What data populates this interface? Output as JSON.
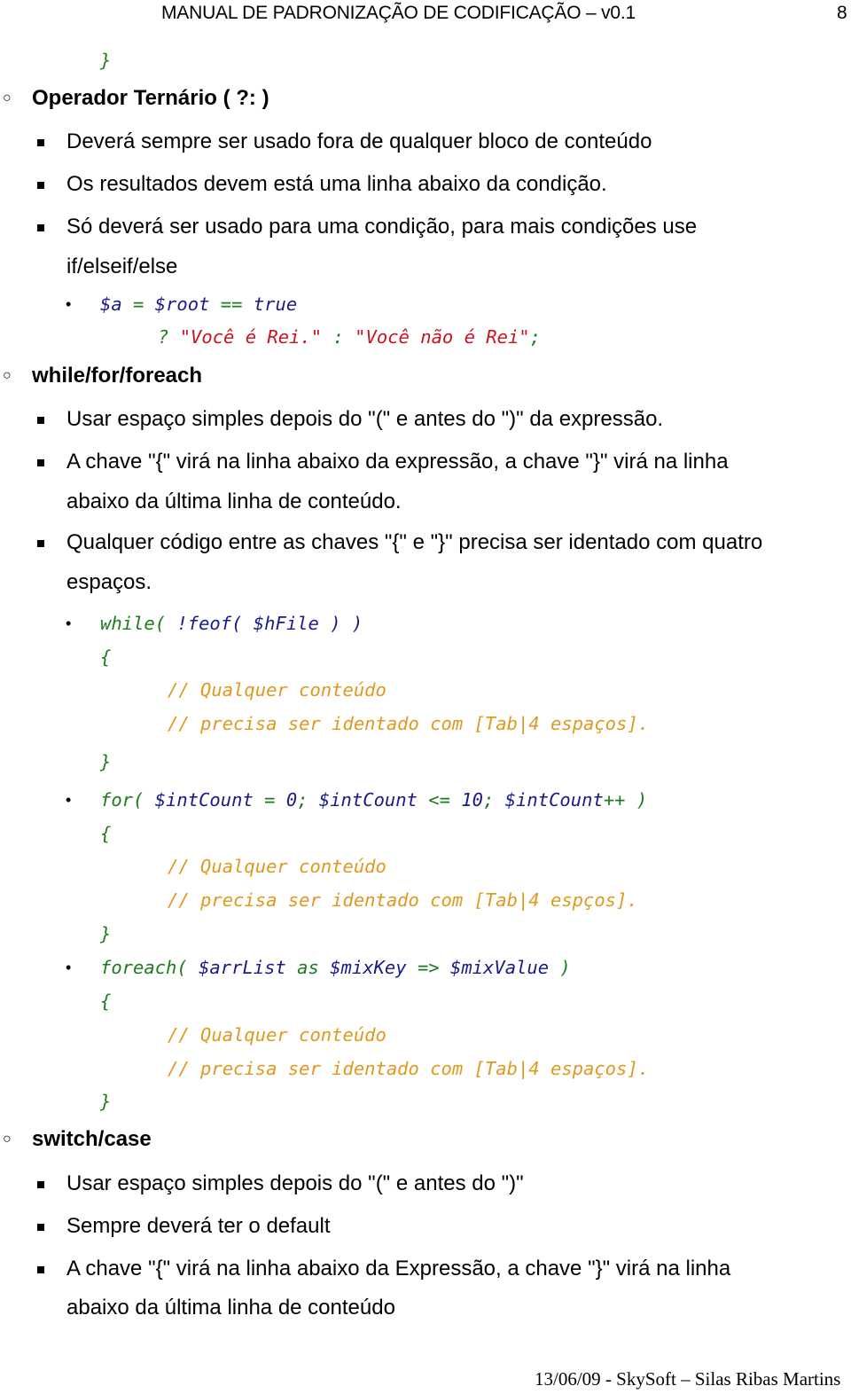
{
  "header": {
    "title": "MANUAL DE PADRONIZAÇÃO DE CODIFICAÇÃO – v0.1",
    "page_number": "8"
  },
  "colors": {
    "keyword": "#1e7a1e",
    "variable": "#1a1a8c",
    "string": "#c8141e",
    "comment": "#e0981e"
  },
  "carry_over": {
    "closing_brace": "}"
  },
  "sections": {
    "ternary": {
      "heading": "Operador Ternário ( ?: )",
      "rules": [
        "Deverá sempre ser usado fora de qualquer bloco de conteúdo",
        "Os resultados devem está uma linha abaixo da condição.",
        "Só deverá ser usado para uma condição, para mais condições use",
        "if/elseif/else"
      ],
      "code": {
        "l1_var_a": "$a",
        "l1_eq": " = ",
        "l1_var_root": "$root",
        "l1_op": " == ",
        "l1_true": "true",
        "l2_q": "? ",
        "l2_str1": "\"Você é Rei.\"",
        "l2_colon": " : ",
        "l2_str2": "\"Você não é Rei\"",
        "l2_semi": ";"
      }
    },
    "loops": {
      "heading": "while/for/foreach",
      "rules": [
        "Usar espaço simples depois do \"(\" e antes do \")\" da expressão.",
        "A chave \"{\" virá na linha abaixo da expressão, a chave \"}\" virá na linha",
        "abaixo da última linha de conteúdo.",
        "Qualquer código entre as chaves \"{\" e \"}\" precisa ser identado com quatro",
        "espaços."
      ],
      "while_code": {
        "kw": "while( ",
        "fn": "!feof( $hFile ) )",
        "open": "{",
        "c1": "// Qualquer conteúdo",
        "c2": "// precisa ser identado com [Tab|4 espaços].",
        "close": "}"
      },
      "for_code": {
        "kw": "for( ",
        "v1": "$intCount",
        "eq": " = ",
        "zero": "0",
        "semi1": "; ",
        "v2": "$intCount",
        "le": " <= ",
        "ten": "10",
        "semi2": "; ",
        "v3": "$intCount",
        "inc": "++ )",
        "open": "{",
        "c1": "// Qualquer conteúdo",
        "c2": "// precisa ser identado com [Tab|4 espços].",
        "close": "}"
      },
      "foreach_code": {
        "kw": "foreach( ",
        "v1": "$arrList",
        "as": " as ",
        "v2": "$mixKey",
        "arrow": " => ",
        "v3": "$mixValue",
        "end": " )",
        "open": "{",
        "c1": "// Qualquer conteúdo",
        "c2": "// precisa ser identado com [Tab|4 espaços].",
        "close": "}"
      }
    },
    "switch": {
      "heading": "switch/case",
      "rules": [
        "Usar espaço simples depois do \"(\" e antes do \")\"",
        "Sempre deverá ter o default",
        "A chave \"{\" virá na linha abaixo da Expressão, a chave \"}\" virá na linha",
        "abaixo da última linha de conteúdo"
      ]
    }
  },
  "bullets": {
    "circle": "○",
    "dot": "•"
  },
  "footer": {
    "text": "13/06/09 - SkySoft – Silas Ribas Martins"
  }
}
